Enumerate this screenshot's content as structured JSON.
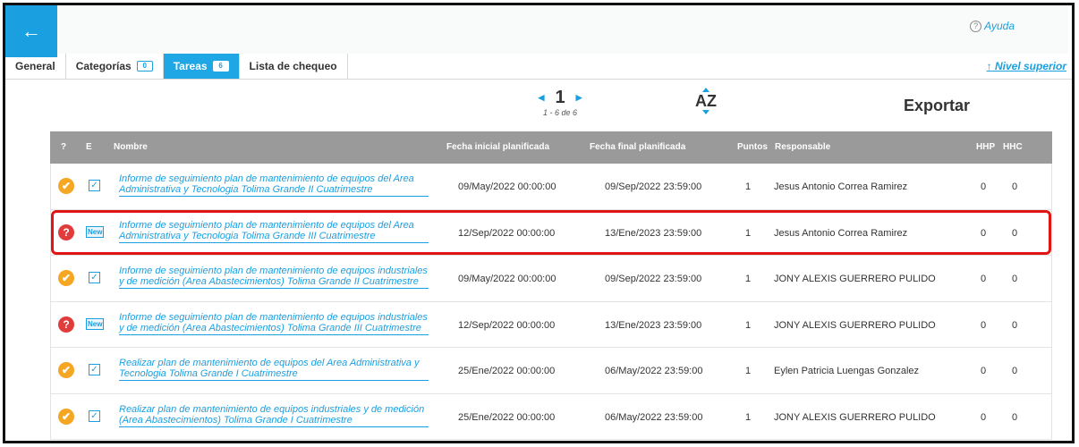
{
  "topbar": {
    "help_label": "Ayuda",
    "help_glyph": "?"
  },
  "tabs": [
    {
      "label": "General"
    },
    {
      "label": "Categorías",
      "count": "0"
    },
    {
      "label": "Tareas",
      "count": "6",
      "active": true
    },
    {
      "label": "Lista de chequeo"
    }
  ],
  "nivel_superior": "Nivel superior",
  "pager": {
    "page": "1",
    "range": "1 - 6 de 6"
  },
  "sort_label": "AZ",
  "export_label": "Exportar",
  "table": {
    "headers": {
      "q": "?",
      "e": "E",
      "nombre": "Nombre",
      "fecha_inicial": "Fecha inicial planificada",
      "fecha_final": "Fecha final planificada",
      "puntos": "Puntos",
      "responsable": "Responsable",
      "hhp": "HHP",
      "hhc": "HHC"
    },
    "rows": [
      {
        "status": "done",
        "e": "check",
        "nombre": "Informe de seguimiento plan de mantenimiento de equipos del Area Administrativa y Tecnologia Tolima Grande II Cuatrimestre",
        "fecha_inicial": "09/May/2022 00:00:00",
        "fecha_final": "09/Sep/2022 23:59:00",
        "puntos": "1",
        "responsable": "Jesus Antonio Correa Ramirez",
        "hhp": "0",
        "hhc": "0"
      },
      {
        "status": "question",
        "e": "New",
        "nombre": "Informe de seguimiento plan de mantenimiento de equipos del Area Administrativa y Tecnologia Tolima Grande III Cuatrimestre",
        "fecha_inicial": "12/Sep/2022 00:00:00",
        "fecha_final": "13/Ene/2023 23:59:00",
        "puntos": "1",
        "responsable": "Jesus Antonio Correa Ramirez",
        "hhp": "0",
        "hhc": "0",
        "highlighted": true
      },
      {
        "status": "done",
        "e": "check",
        "nombre": "Informe de seguimiento plan de mantenimiento de equipos industriales y de medición (Area Abastecimientos) Tolima Grande II Cuatrimestre",
        "fecha_inicial": "09/May/2022 00:00:00",
        "fecha_final": "09/Sep/2022 23:59:00",
        "puntos": "1",
        "responsable": "JONY ALEXIS GUERRERO PULIDO",
        "hhp": "0",
        "hhc": "0"
      },
      {
        "status": "question",
        "e": "New",
        "nombre": "Informe de seguimiento plan de mantenimiento de equipos industriales y de medición (Area Abastecimientos) Tolima Grande III Cuatrimestre",
        "fecha_inicial": "12/Sep/2022 00:00:00",
        "fecha_final": "13/Ene/2023 23:59:00",
        "puntos": "1",
        "responsable": "JONY ALEXIS GUERRERO PULIDO",
        "hhp": "0",
        "hhc": "0"
      },
      {
        "status": "done",
        "e": "check",
        "nombre": "Realizar plan de mantenimiento de equipos del Area Administrativa y Tecnologia Tolima Grande I Cuatrimestre",
        "fecha_inicial": "25/Ene/2022 00:00:00",
        "fecha_final": "06/May/2022 23:59:00",
        "puntos": "1",
        "responsable": "Eylen Patricia Luengas Gonzalez",
        "hhp": "0",
        "hhc": "0"
      },
      {
        "status": "done",
        "e": "check",
        "nombre": "Realizar plan de mantenimiento de equipos industriales y de medición (Area Abastecimientos) Tolima Grande I Cuatrimestre",
        "fecha_inicial": "25/Ene/2022 00:00:00",
        "fecha_final": "06/May/2022 23:59:00",
        "puntos": "1",
        "responsable": "JONY ALEXIS GUERRERO PULIDO",
        "hhp": "0",
        "hhc": "0"
      }
    ]
  },
  "colors": {
    "accent": "#1a9fe0",
    "header": "#9a9a9a",
    "done": "#f5a623",
    "pending": "#e23b3b",
    "highlight": "#e01515"
  }
}
